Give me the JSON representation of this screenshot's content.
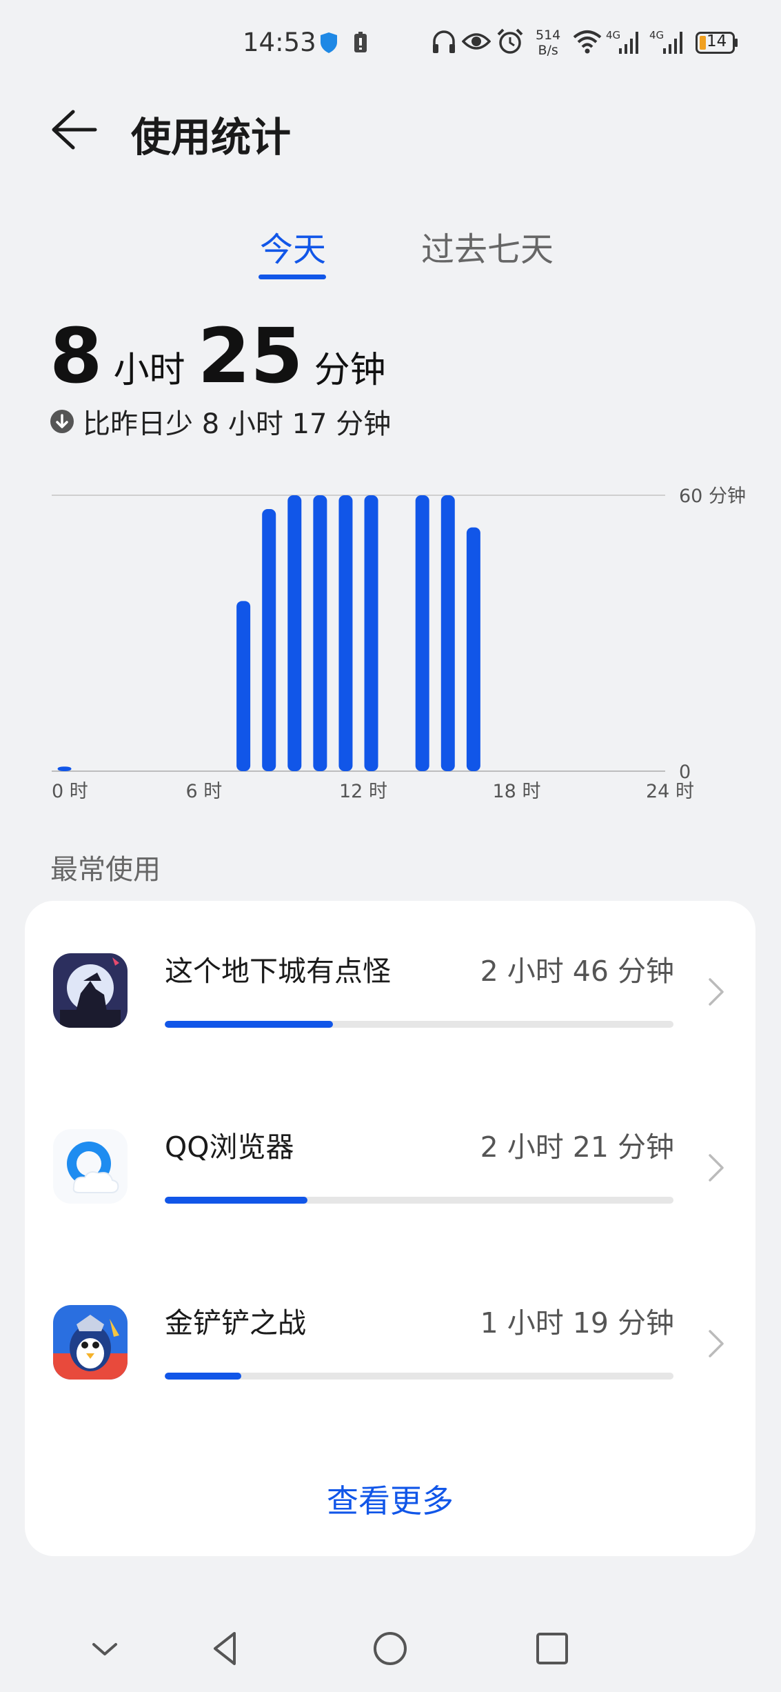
{
  "status_bar": {
    "time": "14:53",
    "net_speed_value": "514",
    "net_speed_unit": "B/s",
    "net_type_1": "4G",
    "net_type_2": "4G",
    "battery_level": "14",
    "icons": [
      "shield-icon",
      "sim-icon",
      "headphones-icon",
      "eye-icon",
      "alarm-icon",
      "wifi-icon",
      "signal-icon",
      "battery-icon"
    ]
  },
  "header": {
    "title": "使用统计"
  },
  "tabs": [
    {
      "label": "今天",
      "active": true
    },
    {
      "label": "过去七天",
      "active": false
    }
  ],
  "summary": {
    "hours": "8",
    "hours_unit": "小时",
    "minutes": "25",
    "minutes_unit": "分钟",
    "compare_text": "比昨日少 8 小时 17 分钟"
  },
  "chart_data": {
    "type": "bar",
    "title": "",
    "x_ticks": [
      "0 时",
      "6 时",
      "12 时",
      "18 时",
      "24 时"
    ],
    "y_ticks": [
      "0",
      "60 分钟"
    ],
    "ylim": [
      0,
      60
    ],
    "categories": [
      "0时",
      "1时",
      "2时",
      "3时",
      "4时",
      "5时",
      "6时",
      "7时",
      "8时",
      "9时",
      "10时",
      "11时",
      "12时",
      "13时",
      "14时",
      "15时",
      "16时",
      "17时",
      "18时",
      "19时",
      "20时",
      "21时",
      "22时",
      "23时"
    ],
    "values": [
      1,
      0,
      0,
      0,
      0,
      0,
      0,
      37,
      57,
      60,
      60,
      60,
      60,
      0,
      60,
      60,
      53,
      0,
      0,
      0,
      0,
      0,
      0,
      0
    ],
    "color": "#1156e8",
    "grid": "top line only"
  },
  "most_used": {
    "title": "最常使用",
    "apps": [
      {
        "name": "这个地下城有点怪",
        "time": "2 小时 46 分钟",
        "fraction": 0.33
      },
      {
        "name": "QQ浏览器",
        "time": "2 小时 21 分钟",
        "fraction": 0.28
      },
      {
        "name": "金铲铲之战",
        "time": "1 小时 19 分钟",
        "fraction": 0.15
      }
    ],
    "see_more": "查看更多"
  },
  "colors": {
    "accent": "#1156e8",
    "background": "#f1f2f4",
    "card": "#ffffff"
  }
}
